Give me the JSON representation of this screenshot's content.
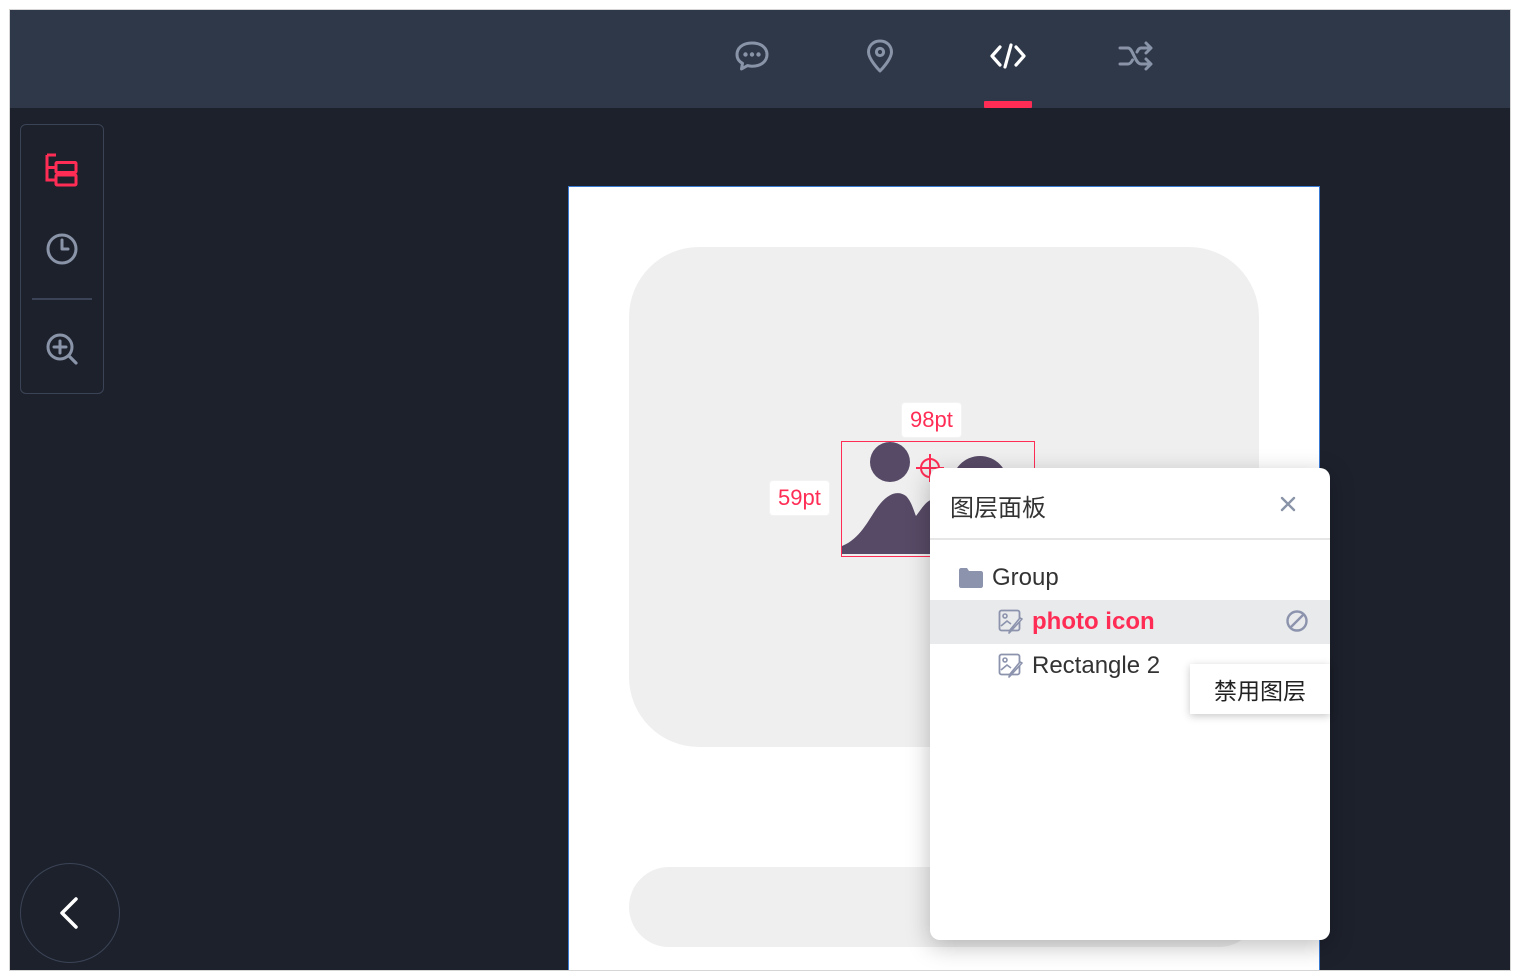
{
  "topbar": {
    "tabs": [
      {
        "icon": "comment-icon"
      },
      {
        "icon": "location-pin-icon"
      },
      {
        "icon": "code-icon",
        "active": true
      },
      {
        "icon": "shuffle-icon"
      }
    ],
    "accent": "#ff2d55"
  },
  "left_toolbar": {
    "tools": [
      {
        "icon": "layers-tree-icon",
        "active": true
      },
      {
        "icon": "clock-icon"
      },
      {
        "icon": "zoom-in-icon"
      }
    ]
  },
  "canvas": {
    "selection": {
      "width_label": "98pt",
      "height_label": "59pt",
      "layer_name": "photo icon"
    }
  },
  "layer_panel": {
    "title": "图层面板",
    "items": [
      {
        "label": "Group",
        "type": "folder"
      },
      {
        "label": "photo icon",
        "type": "layer",
        "selected": true
      },
      {
        "label": "Rectangle 2",
        "type": "layer"
      }
    ],
    "tooltip": "禁用图层"
  },
  "colors": {
    "background": "#1d212c",
    "topbar": "#2e3849",
    "accent": "#ff2d55",
    "artboard_border": "#3a7bd5"
  }
}
